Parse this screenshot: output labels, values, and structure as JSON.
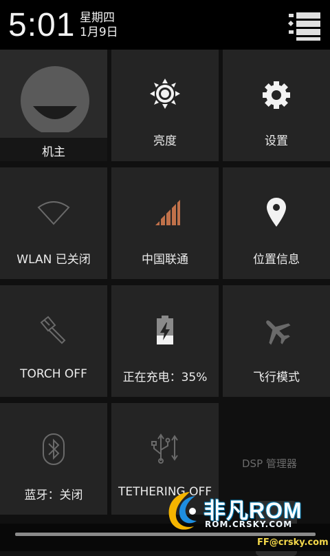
{
  "header": {
    "time": "5:01",
    "weekday": "星期四",
    "date": "1月9日",
    "menu_icon": "list-menu-icon"
  },
  "tiles": {
    "user": {
      "label": "机主",
      "icon": "avatar-icon"
    },
    "brightness": {
      "label": "亮度",
      "icon": "brightness-sun-icon"
    },
    "settings": {
      "label": "设置",
      "icon": "gear-icon"
    },
    "wlan": {
      "label": "WLAN 已关闭",
      "icon": "wifi-off-icon"
    },
    "signal": {
      "label": "中国联通",
      "icon": "signal-bars-icon",
      "color": "#c0714a"
    },
    "location": {
      "label": "位置信息",
      "icon": "location-pin-icon"
    },
    "torch": {
      "label": "TORCH OFF",
      "icon": "flashlight-icon"
    },
    "battery": {
      "label": "正在充电：35%",
      "icon": "battery-charging-icon",
      "level": 0.35
    },
    "airplane": {
      "label": "飞行模式",
      "icon": "airplane-icon"
    },
    "bluetooth": {
      "label": "蓝牙：关闭",
      "icon": "bluetooth-icon"
    },
    "tethering": {
      "label": "TETHERING OFF",
      "icon": "usb-icon"
    }
  },
  "background": {
    "dsp_label": "DSP 管理器"
  },
  "watermark": {
    "title": "非凡ROM",
    "url": "ROM.CRSKY.COM",
    "email": "FF@crsky.com"
  }
}
